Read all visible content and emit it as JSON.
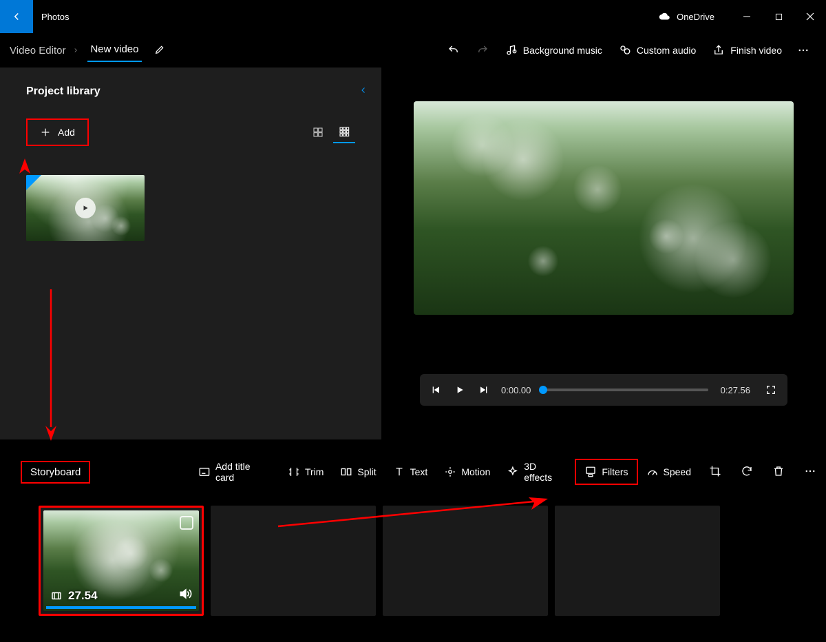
{
  "app": {
    "name": "Photos"
  },
  "cloud": {
    "label": "OneDrive"
  },
  "breadcrumb": {
    "root": "Video Editor",
    "title": "New video"
  },
  "header_actions": {
    "bg_music": "Background music",
    "custom_audio": "Custom audio",
    "finish": "Finish video"
  },
  "library": {
    "title": "Project library",
    "add_label": "Add"
  },
  "playbar": {
    "current": "0:00.00",
    "total": "0:27.56"
  },
  "storyboard": {
    "label": "Storyboard",
    "add_title_card": "Add title card",
    "trim": "Trim",
    "split": "Split",
    "text": "Text",
    "motion": "Motion",
    "effects3d": "3D effects",
    "filters": "Filters",
    "speed": "Speed"
  },
  "clip": {
    "duration": "27.54"
  }
}
